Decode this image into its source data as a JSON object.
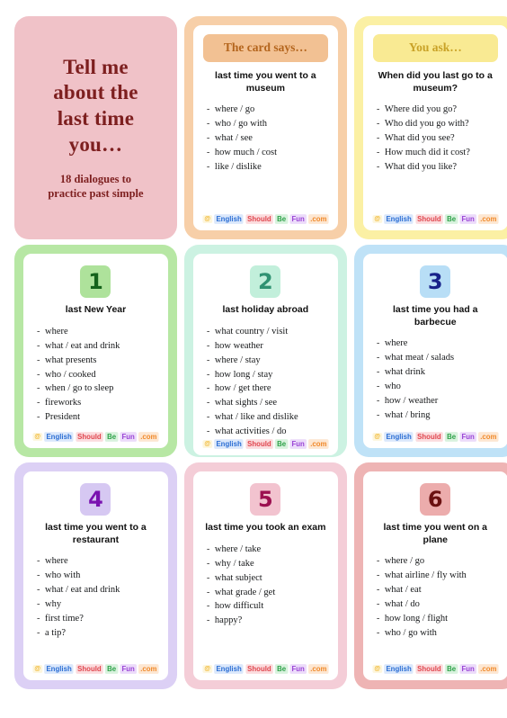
{
  "title_card": {
    "main_line1": "Tell me",
    "main_line2": "about the",
    "main_line3": "last time",
    "main_line4": "you…",
    "subtitle_line1": "18 dialogues to",
    "subtitle_line2": "practice past simple",
    "bg": "#f0c2c8",
    "text_color": "#7d1f1f"
  },
  "logo": {
    "at": "@",
    "english": "English",
    "should": "Should",
    "be": "Be",
    "fun": "Fun",
    "com": ".com"
  },
  "cards": [
    {
      "kind": "example",
      "pill_label": "The card says…",
      "heading": "last time you went to a museum",
      "items": [
        "where / go",
        "who / go with",
        "what / see",
        "how much / cost",
        "like / dislike"
      ],
      "bg": "#f7cfa8",
      "pill_bg": "#f2c193",
      "pill_text": "#b4651d"
    },
    {
      "kind": "example",
      "pill_label": "You ask…",
      "heading": "When did you last go to a museum?",
      "items": [
        "Where did you go?",
        "Who did you go with?",
        "What did you see?",
        "How much did it cost?",
        "What did you like?"
      ],
      "bg": "#fbf0a4",
      "pill_bg": "#f9ea93",
      "pill_text": "#c9a227"
    },
    {
      "kind": "numbered",
      "number": "1",
      "heading": "last New Year",
      "items": [
        "where",
        "what / eat and drink",
        "what presents",
        "who / cooked",
        "when / go to sleep",
        "fireworks",
        "President"
      ],
      "bg": "#b7e7a4",
      "badge_bg": "#aee29b",
      "badge_text": "#15631b"
    },
    {
      "kind": "numbered",
      "number": "2",
      "heading": "last holiday abroad",
      "items": [
        "what country / visit",
        "how weather",
        "where / stay",
        "how long / stay",
        "how / get there",
        "what sights / see",
        "what / like and dislike",
        "what activities / do"
      ],
      "bg": "#ccf2e2",
      "badge_bg": "#c2efdb",
      "badge_text": "#2f9272"
    },
    {
      "kind": "numbered",
      "number": "3",
      "heading": "last time you had a barbecue",
      "items": [
        "where",
        "what meat / salads",
        "what drink",
        "who",
        "how / weather",
        "what / bring"
      ],
      "bg": "#bfe2f7",
      "badge_bg": "#b8def6",
      "badge_text": "#17218a"
    },
    {
      "kind": "numbered",
      "number": "4",
      "heading": "last time you went to a restaurant",
      "items": [
        "where",
        "who with",
        "what / eat and drink",
        "why",
        "first time?",
        "a tip?"
      ],
      "bg": "#dcd0f5",
      "badge_bg": "#d6c8f2",
      "badge_text": "#7a12b0"
    },
    {
      "kind": "numbered",
      "number": "5",
      "heading": "last time you took an exam",
      "items": [
        "where / take",
        "why / take",
        "what subject",
        "what grade / get",
        "how difficult",
        "happy?"
      ],
      "bg": "#f4cdd7",
      "badge_bg": "#f2c3cf",
      "badge_text": "#9c1050"
    },
    {
      "kind": "numbered",
      "number": "6",
      "heading": "last time you went on a plane",
      "items": [
        "where / go",
        "what airline / fly with",
        "what / eat",
        "what / do",
        "how long / flight",
        "who / go with"
      ],
      "bg": "#eeb4b4",
      "badge_bg": "#ecacac",
      "badge_text": "#6b1111"
    }
  ]
}
